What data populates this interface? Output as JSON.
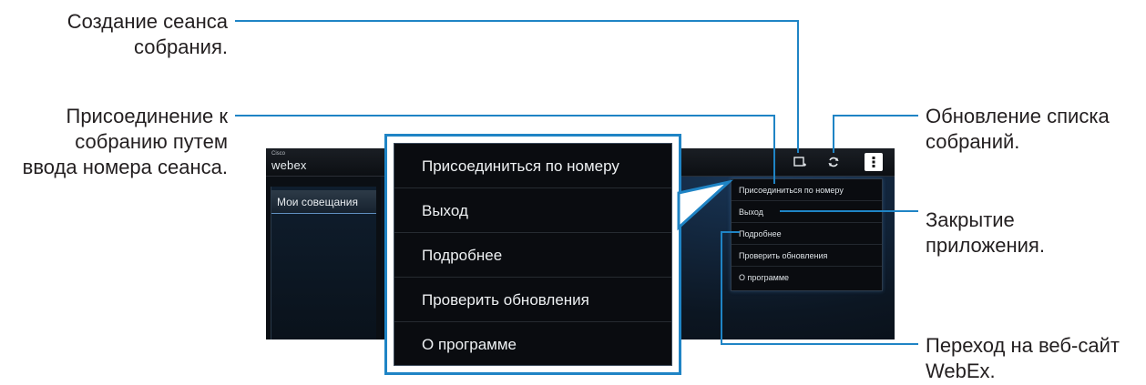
{
  "callouts": {
    "create_meeting": [
      "Создание сеанса",
      "собрания."
    ],
    "join_by_number": [
      "Присоединение к",
      "собранию путем",
      "ввода номера сеанса."
    ],
    "refresh_list": [
      "Обновление списка",
      "собраний."
    ],
    "close_app": [
      "Закрытие",
      "приложения."
    ],
    "go_website": [
      "Переход на веб-сайт",
      "WebEx."
    ]
  },
  "app": {
    "logo_small": "Cisco",
    "logo_main": "webex",
    "sidebar_item": "Мои совещания",
    "icons": {
      "create": "create-meeting-icon",
      "refresh": "refresh-icon",
      "menu": "overflow-menu-icon"
    }
  },
  "menu": {
    "items": [
      "Присоединиться по номеру",
      "Выход",
      "Подробнее",
      "Проверить обновления",
      "О программе"
    ]
  },
  "colors": {
    "callout_line": "#1f84c5",
    "screen_bg": "#0b0f14",
    "text": "#231f20"
  }
}
